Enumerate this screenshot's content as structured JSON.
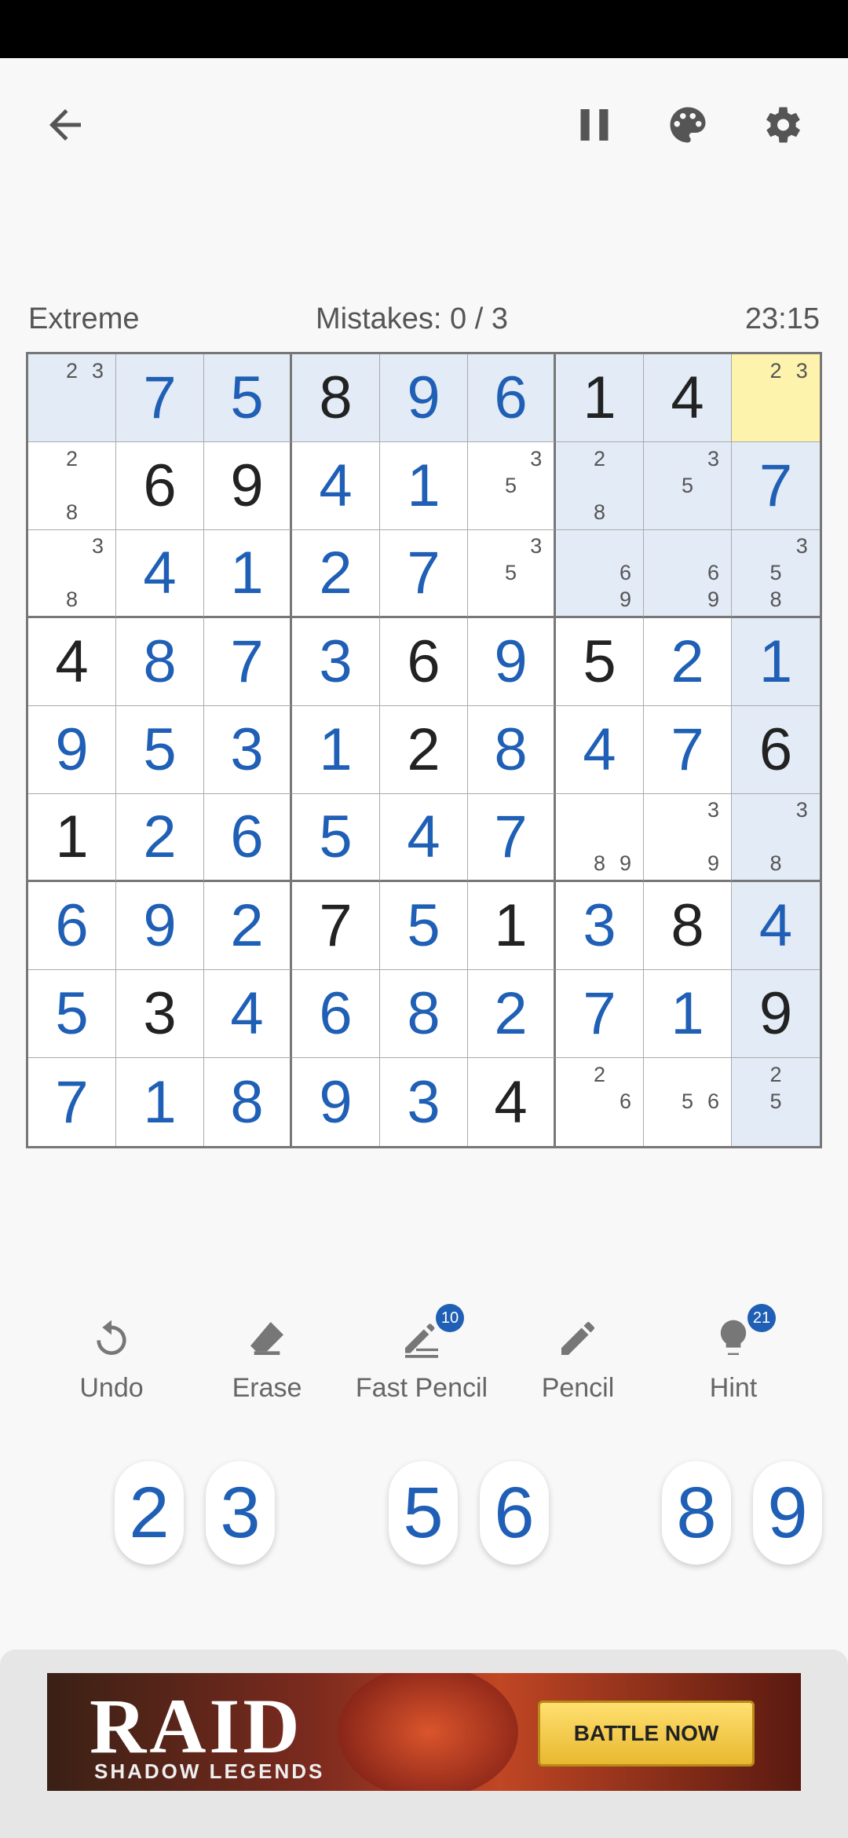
{
  "header": {
    "icons": [
      "back-arrow-icon",
      "pause-icon",
      "palette-icon",
      "gear-icon"
    ]
  },
  "info": {
    "difficulty": "Extreme",
    "mistakes": "Mistakes: 0 / 3",
    "timer": "23:15"
  },
  "board": {
    "cells": [
      [
        {
          "n": [
            2,
            3
          ],
          "h": 1
        },
        {
          "v": "7",
          "u": 1,
          "h": 1
        },
        {
          "v": "5",
          "u": 1,
          "h": 1
        },
        {
          "v": "8",
          "h": 1
        },
        {
          "v": "9",
          "u": 1,
          "h": 1
        },
        {
          "v": "6",
          "u": 1,
          "h": 1
        },
        {
          "v": "1",
          "h": 1
        },
        {
          "v": "4",
          "h": 1
        },
        {
          "n": [
            2,
            3
          ],
          "s": 1
        }
      ],
      [
        {
          "n": [
            2,
            8
          ]
        },
        {
          "v": "6"
        },
        {
          "v": "9"
        },
        {
          "v": "4",
          "u": 1
        },
        {
          "v": "1",
          "u": 1
        },
        {
          "n": [
            3,
            5
          ]
        },
        {
          "n": [
            2,
            8
          ],
          "h": 1
        },
        {
          "n": [
            3,
            5
          ],
          "h": 1
        },
        {
          "v": "7",
          "u": 1,
          "h": 1
        }
      ],
      [
        {
          "n": [
            3,
            8
          ]
        },
        {
          "v": "4",
          "u": 1
        },
        {
          "v": "1",
          "u": 1
        },
        {
          "v": "2",
          "u": 1
        },
        {
          "v": "7",
          "u": 1
        },
        {
          "n": [
            3,
            5
          ]
        },
        {
          "n": [
            6,
            9
          ],
          "h": 1
        },
        {
          "n": [
            6,
            9
          ],
          "h": 1
        },
        {
          "n": [
            3,
            5,
            8
          ],
          "h": 1
        }
      ],
      [
        {
          "v": "4"
        },
        {
          "v": "8",
          "u": 1
        },
        {
          "v": "7",
          "u": 1
        },
        {
          "v": "3",
          "u": 1
        },
        {
          "v": "6"
        },
        {
          "v": "9",
          "u": 1
        },
        {
          "v": "5"
        },
        {
          "v": "2",
          "u": 1
        },
        {
          "v": "1",
          "u": 1,
          "h": 1
        }
      ],
      [
        {
          "v": "9",
          "u": 1
        },
        {
          "v": "5",
          "u": 1
        },
        {
          "v": "3",
          "u": 1
        },
        {
          "v": "1",
          "u": 1
        },
        {
          "v": "2"
        },
        {
          "v": "8",
          "u": 1
        },
        {
          "v": "4",
          "u": 1
        },
        {
          "v": "7",
          "u": 1
        },
        {
          "v": "6",
          "h": 1
        }
      ],
      [
        {
          "v": "1"
        },
        {
          "v": "2",
          "u": 1
        },
        {
          "v": "6",
          "u": 1
        },
        {
          "v": "5",
          "u": 1
        },
        {
          "v": "4",
          "u": 1
        },
        {
          "v": "7",
          "u": 1
        },
        {
          "n": [
            8,
            9
          ]
        },
        {
          "n": [
            3,
            9
          ]
        },
        {
          "n": [
            3,
            8
          ],
          "h": 1
        }
      ],
      [
        {
          "v": "6",
          "u": 1
        },
        {
          "v": "9",
          "u": 1
        },
        {
          "v": "2",
          "u": 1
        },
        {
          "v": "7"
        },
        {
          "v": "5",
          "u": 1
        },
        {
          "v": "1"
        },
        {
          "v": "3",
          "u": 1
        },
        {
          "v": "8"
        },
        {
          "v": "4",
          "u": 1,
          "h": 1
        }
      ],
      [
        {
          "v": "5",
          "u": 1
        },
        {
          "v": "3"
        },
        {
          "v": "4",
          "u": 1
        },
        {
          "v": "6",
          "u": 1
        },
        {
          "v": "8",
          "u": 1
        },
        {
          "v": "2",
          "u": 1
        },
        {
          "v": "7",
          "u": 1
        },
        {
          "v": "1",
          "u": 1
        },
        {
          "v": "9",
          "h": 1
        }
      ],
      [
        {
          "v": "7",
          "u": 1
        },
        {
          "v": "1",
          "u": 1
        },
        {
          "v": "8",
          "u": 1
        },
        {
          "v": "9",
          "u": 1
        },
        {
          "v": "3",
          "u": 1
        },
        {
          "v": "4"
        },
        {
          "n": [
            2,
            6
          ]
        },
        {
          "n": [
            5,
            6
          ]
        },
        {
          "n": [
            2,
            5
          ],
          "h": 1
        }
      ]
    ]
  },
  "actions": [
    {
      "label": "Undo",
      "icon": "undo-icon"
    },
    {
      "label": "Erase",
      "icon": "eraser-icon"
    },
    {
      "label": "Fast Pencil",
      "icon": "fast-pencil-icon",
      "badge": "10"
    },
    {
      "label": "Pencil",
      "icon": "pencil-icon"
    },
    {
      "label": "Hint",
      "icon": "lightbulb-icon",
      "badge": "21"
    }
  ],
  "numpad": [
    "2",
    "3",
    "5",
    "6",
    "8",
    "9"
  ],
  "ad": {
    "brand": "RAID",
    "subtitle": "SHADOW LEGENDS",
    "cta": "BATTLE NOW"
  },
  "colors": {
    "user_digit": "#1f5fb5",
    "highlight": "#e2ebf6",
    "selected": "#fdf3ad"
  }
}
